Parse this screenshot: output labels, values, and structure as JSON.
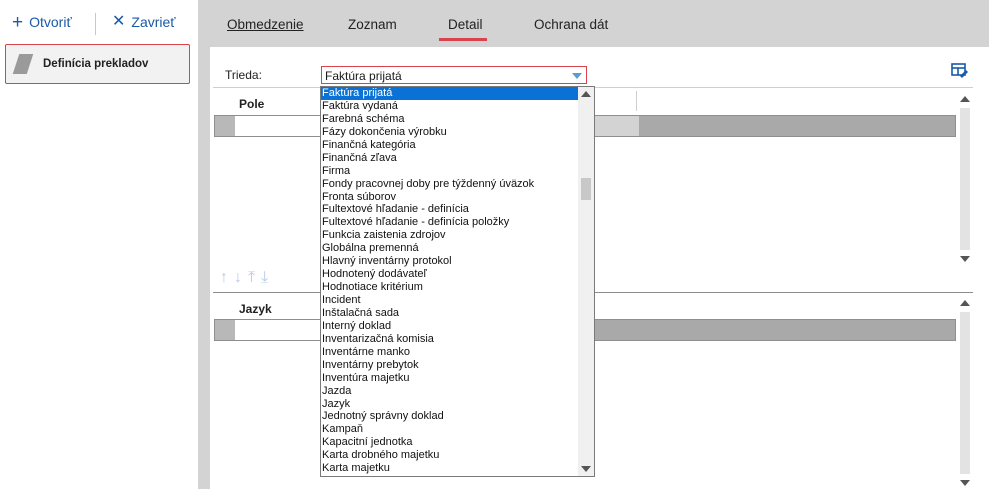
{
  "toolbar": {
    "open_label": "Otvoriť",
    "close_label": "Zavrieť",
    "open_icon": "+",
    "close_icon": "✕"
  },
  "sidebar": {
    "items": [
      {
        "label": "Definícia prekladov"
      }
    ]
  },
  "tabs": [
    {
      "label": "Obmedzenie"
    },
    {
      "label": "Zoznam"
    },
    {
      "label": "Detail",
      "active": true
    },
    {
      "label": "Ochrana dát"
    }
  ],
  "form": {
    "trieda_label": "Trieda:",
    "trieda_value": "Faktúra prijatá"
  },
  "grid1": {
    "column": "Pole"
  },
  "grid2": {
    "column": "Jazyk"
  },
  "move_icons": [
    "↑",
    "↓",
    "⤒",
    "⤓"
  ],
  "dropdown": {
    "items": [
      "Faktúra prijatá",
      "Faktúra vydaná",
      "Farebná schéma",
      "Fázy dokončenia výrobku",
      "Finančná kategória",
      "Finančná zľava",
      "Firma",
      "Fondy pracovnej doby pre týždenný úväzok",
      "Fronta súborov",
      "Fultextové hľadanie - definícia",
      "Fultextové hľadanie - definícia položky",
      "Funkcia zaistenia zdrojov",
      "Globálna premenná",
      "Hlavný inventárny protokol",
      "Hodnotený dodávateľ",
      "Hodnotiace kritérium",
      "Incident",
      "Inštalačná sada",
      "Interný doklad",
      "Inventarizačná komisia",
      "Inventárne manko",
      "Inventárny prebytok",
      "Inventúra majetku",
      "Jazda",
      "Jazyk",
      "Jednotný správny doklad",
      "Kampaň",
      "Kapacitní jednotka",
      "Karta drobného majetku",
      "Karta majetku"
    ],
    "selected_index": 0
  },
  "colors": {
    "accent": "#d9434b",
    "link": "#1a5aa8",
    "selection": "#0a72d6",
    "workspace": "#d3d3d3"
  }
}
